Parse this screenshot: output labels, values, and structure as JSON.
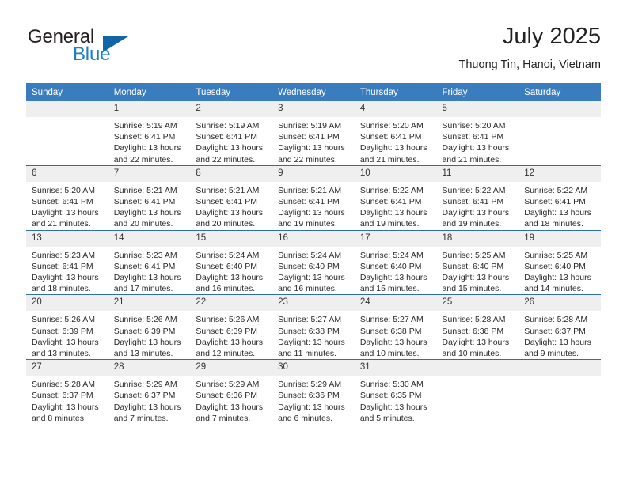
{
  "logo": {
    "word_top": "General",
    "word_bottom": "Blue",
    "triangle": "triangle-icon",
    "colors": {
      "dark": "#231f20",
      "blue": "#1f7fc4",
      "triangle": "#1266a8"
    }
  },
  "header": {
    "title": "July 2025",
    "subtitle": "Thuong Tin, Hanoi, Vietnam"
  },
  "theme": {
    "header_bg": "#3a7dbf",
    "row_divider": "#2e6da8",
    "daynum_band_bg": "#efefef",
    "page_bg": "#ffffff"
  },
  "calendar": {
    "weekday_headers": [
      "Sunday",
      "Monday",
      "Tuesday",
      "Wednesday",
      "Thursday",
      "Friday",
      "Saturday"
    ],
    "labels": {
      "sunrise": "Sunrise:",
      "sunset": "Sunset:",
      "daylight": "Daylight:"
    },
    "weeks": [
      [
        {
          "empty": true,
          "day": ""
        },
        {
          "day": "1",
          "sunrise": "Sunrise: 5:19 AM",
          "sunset": "Sunset: 6:41 PM",
          "daylight": "Daylight: 13 hours and 22 minutes."
        },
        {
          "day": "2",
          "sunrise": "Sunrise: 5:19 AM",
          "sunset": "Sunset: 6:41 PM",
          "daylight": "Daylight: 13 hours and 22 minutes."
        },
        {
          "day": "3",
          "sunrise": "Sunrise: 5:19 AM",
          "sunset": "Sunset: 6:41 PM",
          "daylight": "Daylight: 13 hours and 22 minutes."
        },
        {
          "day": "4",
          "sunrise": "Sunrise: 5:20 AM",
          "sunset": "Sunset: 6:41 PM",
          "daylight": "Daylight: 13 hours and 21 minutes."
        },
        {
          "day": "5",
          "sunrise": "Sunrise: 5:20 AM",
          "sunset": "Sunset: 6:41 PM",
          "daylight": "Daylight: 13 hours and 21 minutes."
        },
        {
          "empty": true,
          "day": ""
        }
      ],
      [
        {
          "day": "6",
          "sunrise": "Sunrise: 5:20 AM",
          "sunset": "Sunset: 6:41 PM",
          "daylight": "Daylight: 13 hours and 21 minutes."
        },
        {
          "day": "7",
          "sunrise": "Sunrise: 5:21 AM",
          "sunset": "Sunset: 6:41 PM",
          "daylight": "Daylight: 13 hours and 20 minutes."
        },
        {
          "day": "8",
          "sunrise": "Sunrise: 5:21 AM",
          "sunset": "Sunset: 6:41 PM",
          "daylight": "Daylight: 13 hours and 20 minutes."
        },
        {
          "day": "9",
          "sunrise": "Sunrise: 5:21 AM",
          "sunset": "Sunset: 6:41 PM",
          "daylight": "Daylight: 13 hours and 19 minutes."
        },
        {
          "day": "10",
          "sunrise": "Sunrise: 5:22 AM",
          "sunset": "Sunset: 6:41 PM",
          "daylight": "Daylight: 13 hours and 19 minutes."
        },
        {
          "day": "11",
          "sunrise": "Sunrise: 5:22 AM",
          "sunset": "Sunset: 6:41 PM",
          "daylight": "Daylight: 13 hours and 19 minutes."
        },
        {
          "day": "12",
          "sunrise": "Sunrise: 5:22 AM",
          "sunset": "Sunset: 6:41 PM",
          "daylight": "Daylight: 13 hours and 18 minutes."
        }
      ],
      [
        {
          "day": "13",
          "sunrise": "Sunrise: 5:23 AM",
          "sunset": "Sunset: 6:41 PM",
          "daylight": "Daylight: 13 hours and 18 minutes."
        },
        {
          "day": "14",
          "sunrise": "Sunrise: 5:23 AM",
          "sunset": "Sunset: 6:41 PM",
          "daylight": "Daylight: 13 hours and 17 minutes."
        },
        {
          "day": "15",
          "sunrise": "Sunrise: 5:24 AM",
          "sunset": "Sunset: 6:40 PM",
          "daylight": "Daylight: 13 hours and 16 minutes."
        },
        {
          "day": "16",
          "sunrise": "Sunrise: 5:24 AM",
          "sunset": "Sunset: 6:40 PM",
          "daylight": "Daylight: 13 hours and 16 minutes."
        },
        {
          "day": "17",
          "sunrise": "Sunrise: 5:24 AM",
          "sunset": "Sunset: 6:40 PM",
          "daylight": "Daylight: 13 hours and 15 minutes."
        },
        {
          "day": "18",
          "sunrise": "Sunrise: 5:25 AM",
          "sunset": "Sunset: 6:40 PM",
          "daylight": "Daylight: 13 hours and 15 minutes."
        },
        {
          "day": "19",
          "sunrise": "Sunrise: 5:25 AM",
          "sunset": "Sunset: 6:40 PM",
          "daylight": "Daylight: 13 hours and 14 minutes."
        }
      ],
      [
        {
          "day": "20",
          "sunrise": "Sunrise: 5:26 AM",
          "sunset": "Sunset: 6:39 PM",
          "daylight": "Daylight: 13 hours and 13 minutes."
        },
        {
          "day": "21",
          "sunrise": "Sunrise: 5:26 AM",
          "sunset": "Sunset: 6:39 PM",
          "daylight": "Daylight: 13 hours and 13 minutes."
        },
        {
          "day": "22",
          "sunrise": "Sunrise: 5:26 AM",
          "sunset": "Sunset: 6:39 PM",
          "daylight": "Daylight: 13 hours and 12 minutes."
        },
        {
          "day": "23",
          "sunrise": "Sunrise: 5:27 AM",
          "sunset": "Sunset: 6:38 PM",
          "daylight": "Daylight: 13 hours and 11 minutes."
        },
        {
          "day": "24",
          "sunrise": "Sunrise: 5:27 AM",
          "sunset": "Sunset: 6:38 PM",
          "daylight": "Daylight: 13 hours and 10 minutes."
        },
        {
          "day": "25",
          "sunrise": "Sunrise: 5:28 AM",
          "sunset": "Sunset: 6:38 PM",
          "daylight": "Daylight: 13 hours and 10 minutes."
        },
        {
          "day": "26",
          "sunrise": "Sunrise: 5:28 AM",
          "sunset": "Sunset: 6:37 PM",
          "daylight": "Daylight: 13 hours and 9 minutes."
        }
      ],
      [
        {
          "day": "27",
          "sunrise": "Sunrise: 5:28 AM",
          "sunset": "Sunset: 6:37 PM",
          "daylight": "Daylight: 13 hours and 8 minutes."
        },
        {
          "day": "28",
          "sunrise": "Sunrise: 5:29 AM",
          "sunset": "Sunset: 6:37 PM",
          "daylight": "Daylight: 13 hours and 7 minutes."
        },
        {
          "day": "29",
          "sunrise": "Sunrise: 5:29 AM",
          "sunset": "Sunset: 6:36 PM",
          "daylight": "Daylight: 13 hours and 7 minutes."
        },
        {
          "day": "30",
          "sunrise": "Sunrise: 5:29 AM",
          "sunset": "Sunset: 6:36 PM",
          "daylight": "Daylight: 13 hours and 6 minutes."
        },
        {
          "day": "31",
          "sunrise": "Sunrise: 5:30 AM",
          "sunset": "Sunset: 6:35 PM",
          "daylight": "Daylight: 13 hours and 5 minutes."
        },
        {
          "empty": true,
          "day": ""
        },
        {
          "empty": true,
          "day": ""
        }
      ]
    ]
  }
}
